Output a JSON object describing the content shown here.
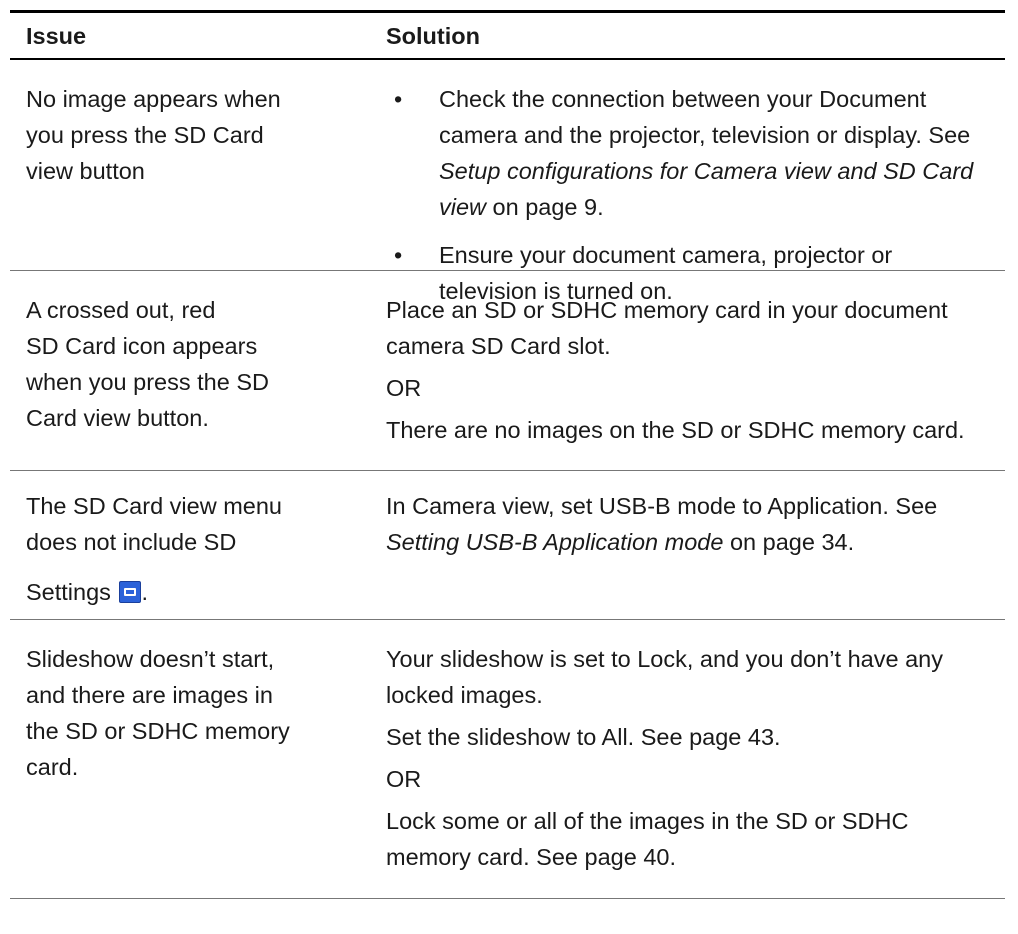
{
  "headers": {
    "issue": "Issue",
    "solution": "Solution"
  },
  "rows": [
    {
      "issue": [
        "No image appears when",
        "you press the SD Card",
        "view button"
      ],
      "bullets": [
        {
          "parts": [
            "Check the connection between your Document camera and the projector, television or display. See ",
            "Setup configurations for Camera view and SD Card view",
            " on page 9."
          ]
        },
        {
          "text": "Ensure your document camera, projector or television is turned on."
        }
      ]
    },
    {
      "issue": [
        "A crossed out, red",
        "SD Card icon appears",
        "when you press the SD",
        "Card view button."
      ],
      "paragraphs": [
        "Place an SD or SDHC memory card in your document camera SD Card slot.",
        "OR",
        "There are no images on the SD or SDHC memory card."
      ]
    },
    {
      "issue": [
        "The SD Card view menu",
        "does not include SD",
        "Settings",
        "."
      ],
      "icon": "sd-settings-icon",
      "parts": [
        "In Camera view, set USB-B mode to Application. See ",
        "Setting USB-B Application mode",
        " on page 34."
      ]
    },
    {
      "issue": [
        "Slideshow doesn’t start,",
        "and there are images in",
        "the SD or SDHC memory",
        "card."
      ],
      "paragraphs": [
        "Your slideshow is set to Lock, and you don’t have any locked images.",
        "Set the slideshow to All. See page 43.",
        "OR",
        "Lock some or all of the images in the SD or SDHC memory card. See page 40."
      ]
    }
  ]
}
